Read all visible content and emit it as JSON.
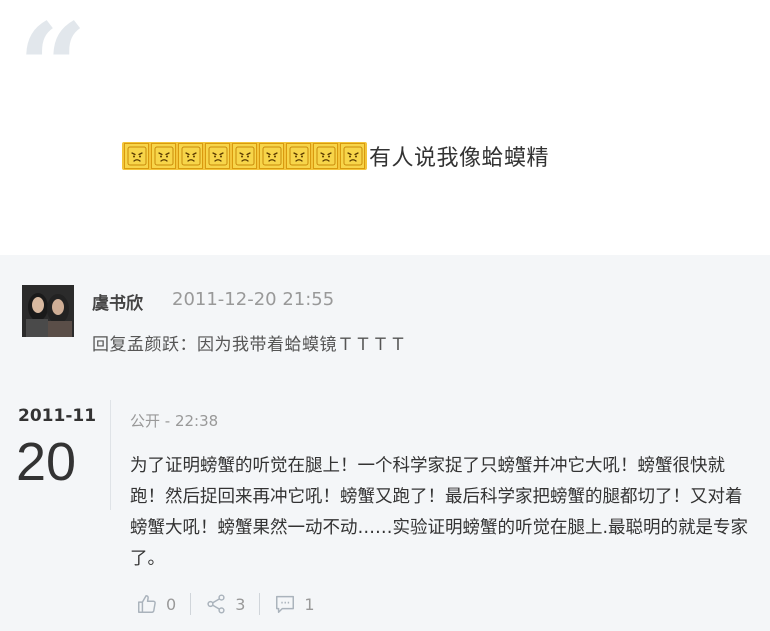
{
  "post": {
    "emoji_count": 9,
    "emoji_name": "sad-face-emoji",
    "text": "有人说我像蛤蟆精"
  },
  "reply": {
    "name": "虞书欣",
    "time": "2011-12-20 21:55",
    "text": "回复孟颜跃：因为我带着蛤蟆镜ＴＴＴＴ"
  },
  "entry": {
    "date_ym": "2011-11",
    "date_day": "20",
    "meta": "公开 - 22:38",
    "body": "为了证明螃蟹的听觉在腿上！一个科学家捉了只螃蟹并冲它大吼！螃蟹很快就跑！然后捉回来再冲它吼！螃蟹又跑了！最后科学家把螃蟹的腿都切了！又对着螃蟹大吼！螃蟹果然一动不动……实验证明螃蟹的听觉在腿上.最聪明的就是专家了。",
    "likes": "0",
    "shares": "3",
    "comments": "1"
  },
  "colors": {
    "background_bottom": "#f4f6f8",
    "quote_mark": "#e2e7ec",
    "emoji_fill": "#f7d54a",
    "muted_text": "#999999"
  }
}
